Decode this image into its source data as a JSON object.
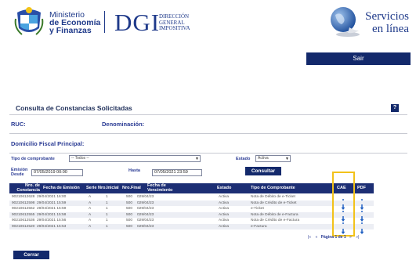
{
  "header": {
    "ministerio_line1": "Ministerio",
    "ministerio_line2": "de Economía",
    "ministerio_line3": "y Finanzas",
    "dgi": "DGI",
    "dgi_sub1": "DIRECCIÓN",
    "dgi_sub2": "GENERAL",
    "dgi_sub3": "IMPOSITIVA",
    "servicios_line1": "Servicios",
    "servicios_line2": "en línea",
    "sair_label": "Sair"
  },
  "panel": {
    "title": "Consulta de Constancias Solicitadas",
    "help_label": "?",
    "ruc_label": "RUC:",
    "denominacion_label": "Denominación:",
    "domicilio_label": "Domicilio Fiscal Principal:"
  },
  "filters": {
    "tipo_label": "Tipo de comprobante",
    "tipo_value": "-- Todos --",
    "estado_label": "Estado",
    "estado_value": "Activa",
    "emision_label1": "Emisión",
    "emision_label2": "Desde",
    "emision_value": "07/05/2019 00:00",
    "hasta_label": "Hasta",
    "hasta_value": "07/05/2021 23:59",
    "consultar_label": "Consultar"
  },
  "table": {
    "headers": {
      "nro_line1": "Nro. de",
      "nro_line2": "Constancia",
      "fecha_emision": "Fecha de Emisión",
      "serie": "Serie",
      "nro_inicial": "Nro.Inicial",
      "nro_final": "Nro.Final",
      "venc_line1": "Fecha de",
      "venc_line2": "Vencimiento",
      "estado": "Estado",
      "tipo": "Tipo de Comprobante",
      "cae": "CAE",
      "pdf": "PDF"
    },
    "rows": [
      {
        "nro": "90210612628",
        "fecha": "29/04/2021 16:00",
        "serie": "A",
        "inicial": "1",
        "final": "500",
        "venc": "029/04/23",
        "estado": "Activa",
        "tipo": "Nota de Débito de e-Ticket"
      },
      {
        "nro": "90210612598",
        "fecha": "29/04/2021 15:59",
        "serie": "A",
        "inicial": "1",
        "final": "500",
        "venc": "029/04/23",
        "estado": "Activa",
        "tipo": "Nota de Crédito de e-Ticket"
      },
      {
        "nro": "90210612562",
        "fecha": "29/04/2021 15:59",
        "serie": "A",
        "inicial": "1",
        "final": "500",
        "venc": "029/04/23",
        "estado": "Activa",
        "tipo": "e-Ticket"
      },
      {
        "nro": "90210612555",
        "fecha": "29/04/2021 15:58",
        "serie": "A",
        "inicial": "1",
        "final": "500",
        "venc": "029/04/23",
        "estado": "Activa",
        "tipo": "Nota de Débito de e-Factura"
      },
      {
        "nro": "90210612536",
        "fecha": "29/04/2021 15:56",
        "serie": "A",
        "inicial": "1",
        "final": "500",
        "venc": "029/04/23",
        "estado": "Activa",
        "tipo": "Nota de Crédito de e-Factura"
      },
      {
        "nro": "90210612520",
        "fecha": "29/04/2021 15:53",
        "serie": "A",
        "inicial": "1",
        "final": "500",
        "venc": "029/04/23",
        "estado": "Activa",
        "tipo": "e-Factura"
      }
    ]
  },
  "pager": {
    "first": "|«",
    "prev": "«",
    "label": "Página 1 de 1",
    "next": "»",
    "last": "»|"
  },
  "footer": {
    "cerrar_label": "Cerrar"
  },
  "colors": {
    "navy": "#13296b",
    "table_header": "#1c2e74",
    "highlight": "#f2c21a",
    "download_icon": "#1f5fc2"
  },
  "icons": {
    "cae": "download-arrow-icon",
    "pdf": "download-arrow-icon",
    "seal": "uruguay-coat-of-arms-icon",
    "globe": "globe-icon"
  }
}
